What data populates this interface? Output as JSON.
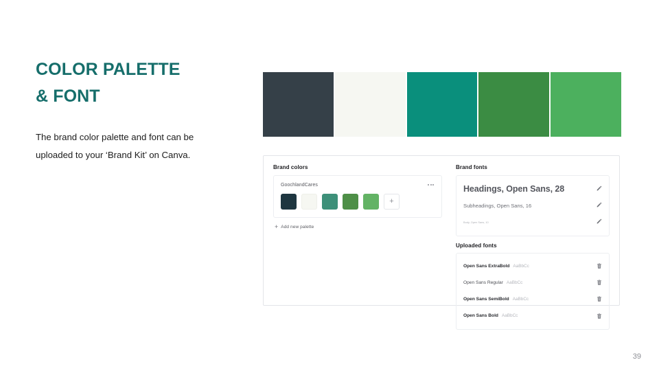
{
  "slide": {
    "title": "COLOR PALETTE\n& FONT",
    "body": "The brand color palette and font can be uploaded to your ‘Brand Kit’ on Canva.",
    "title_color": "#166E6B",
    "page_number": "39"
  },
  "swatch_strip": [
    {
      "name": "dark-slate",
      "hex": "#354048"
    },
    {
      "name": "off-white",
      "hex": "#F6F7F2"
    },
    {
      "name": "teal",
      "hex": "#0A8F7C"
    },
    {
      "name": "dark-green",
      "hex": "#3B8C43"
    },
    {
      "name": "mid-green",
      "hex": "#4CB05E"
    }
  ],
  "canva": {
    "brand_colors": {
      "heading": "Brand colors",
      "palette_name": "GoochlandCares",
      "menu_icon": "three-dots-icon",
      "swatches": [
        {
          "name": "dark-slate",
          "hex": "#1E3640"
        },
        {
          "name": "off-white",
          "hex": "#F6F7F2"
        },
        {
          "name": "teal",
          "hex": "#3D9079"
        },
        {
          "name": "dark-green",
          "hex": "#4E8F47"
        },
        {
          "name": "mid-green",
          "hex": "#63B365"
        }
      ],
      "add_swatch_label": "+",
      "add_palette_label": "Add new palette",
      "add_palette_icon": "plus-icon"
    },
    "brand_fonts": {
      "heading": "Brand fonts",
      "rows": [
        {
          "label": "Headings, Open Sans, 28",
          "style": "heading",
          "edit_icon": "pencil-icon"
        },
        {
          "label": "Subheadings, Open Sans, 16",
          "style": "sub",
          "edit_icon": "pencil-icon"
        },
        {
          "label": "Body, Open Sans, 10",
          "style": "body",
          "edit_icon": "pencil-icon"
        }
      ]
    },
    "uploaded_fonts": {
      "heading": "Uploaded fonts",
      "rows": [
        {
          "name": "Open Sans ExtraBold",
          "preview": "AaBbCc",
          "weight": "bold",
          "delete_icon": "trash-icon"
        },
        {
          "name": "Open Sans Regular",
          "preview": "AaBbCc",
          "weight": "regular",
          "delete_icon": "trash-icon"
        },
        {
          "name": "Open Sans SemiBold",
          "preview": "AaBbCc",
          "weight": "bold",
          "delete_icon": "trash-icon"
        },
        {
          "name": "Open Sans Bold",
          "preview": "AaBbCc",
          "weight": "bold",
          "delete_icon": "trash-icon"
        }
      ]
    }
  }
}
